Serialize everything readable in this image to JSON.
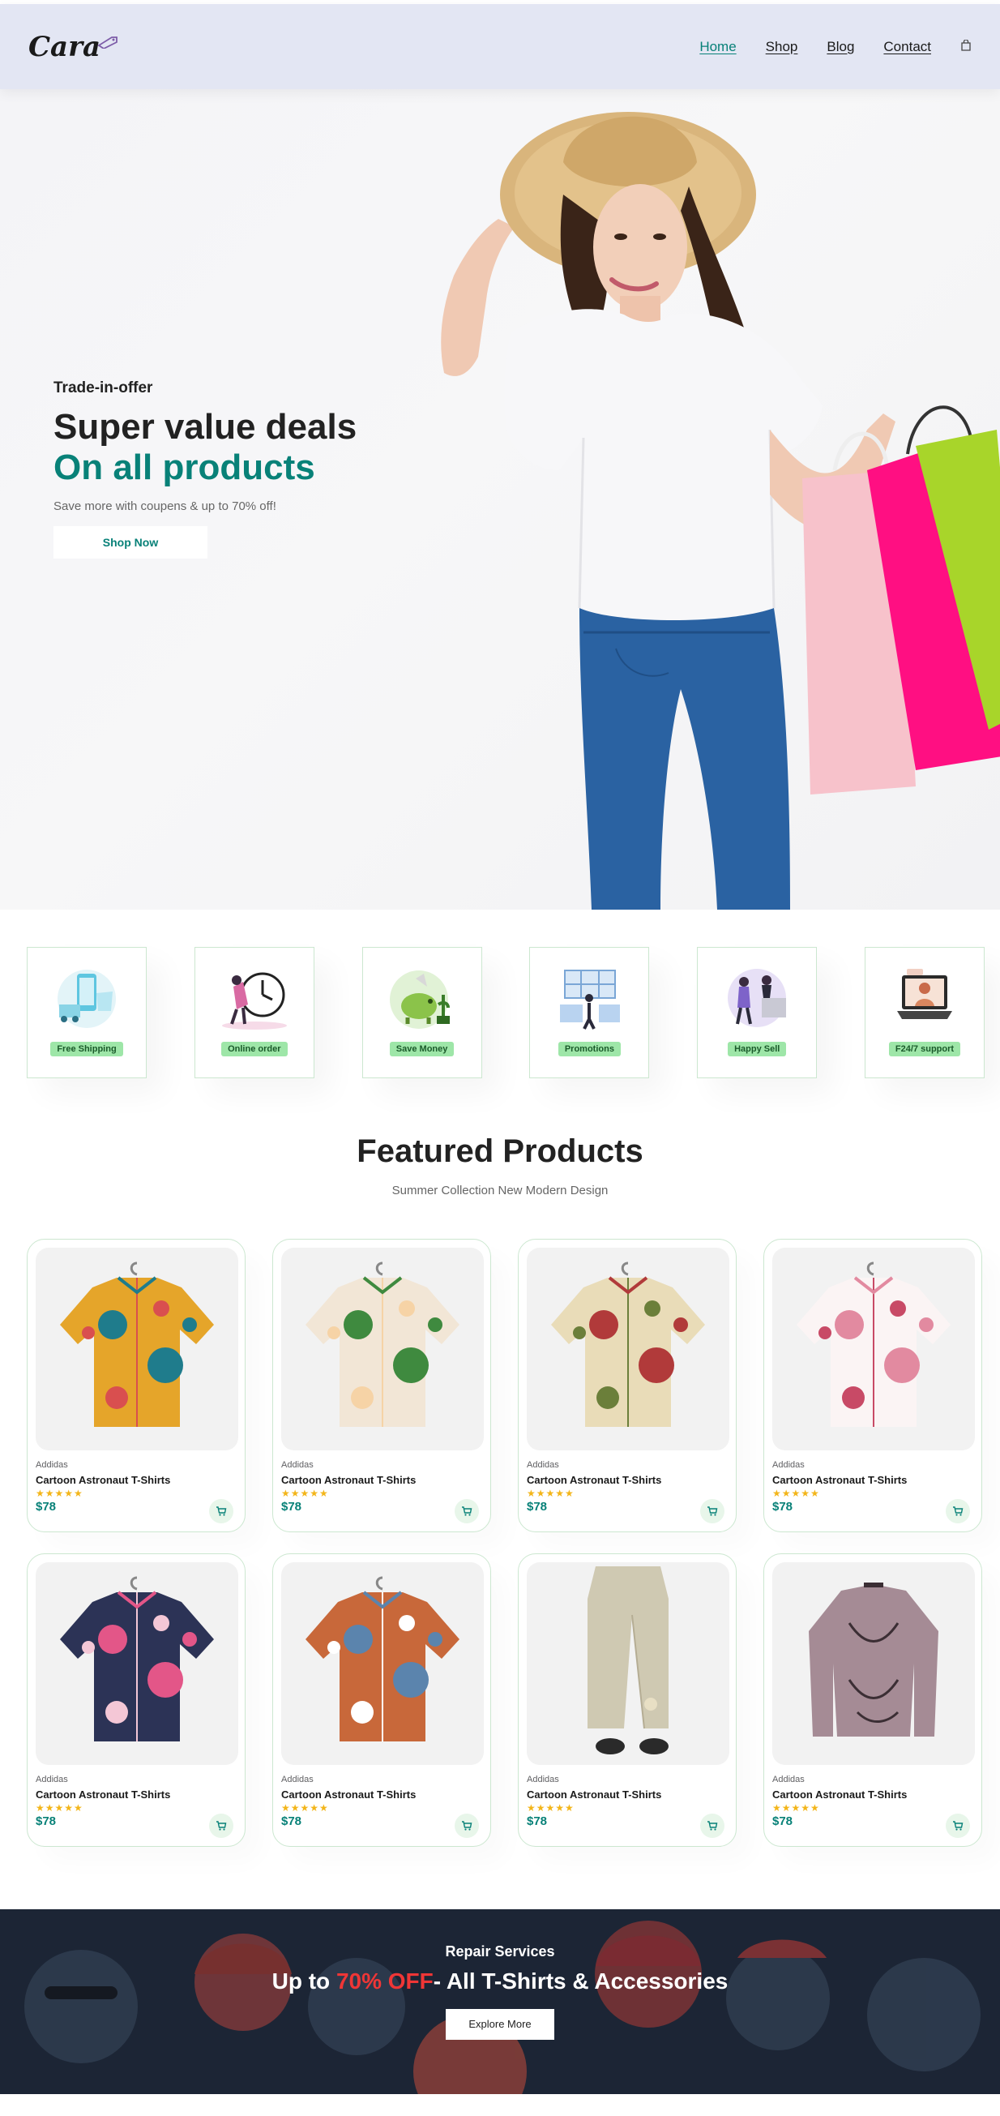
{
  "header": {
    "logo_text": "Cara",
    "nav": [
      {
        "label": "Home",
        "active": true
      },
      {
        "label": "Shop"
      },
      {
        "label": "Blog"
      },
      {
        "label": "Contact"
      }
    ],
    "cart_icon": "bag-icon"
  },
  "hero": {
    "kicker": "Trade-in-offer",
    "title_line1": "Super value deals",
    "title_line2": "On all products",
    "subtitle": "Save more with coupens & up to 70% off!",
    "button": "Shop Now"
  },
  "features": [
    {
      "label": "Free Shipping",
      "icon": "phone-shipping-illustration"
    },
    {
      "label": "Online order",
      "icon": "clock-order-illustration"
    },
    {
      "label": "Save Money",
      "icon": "piggy-bank-illustration"
    },
    {
      "label": "Promotions",
      "icon": "promotions-illustration"
    },
    {
      "label": "Happy Sell",
      "icon": "happy-sell-illustration"
    },
    {
      "label": "F24/7 support",
      "icon": "support-illustration"
    }
  ],
  "featured": {
    "title": "Featured Products",
    "subtitle": "Summer Collection New Modern Design",
    "products": [
      {
        "brand": "Addidas",
        "name": "Cartoon Astronaut T-Shirts",
        "rating": 5,
        "price": "$78",
        "stars": "★★★★★",
        "colors": [
          "#e5a52a",
          "#1f7c8c",
          "#d94f4f"
        ]
      },
      {
        "brand": "Addidas",
        "name": "Cartoon Astronaut T-Shirts",
        "rating": 5,
        "price": "$78",
        "stars": "★★★★★",
        "colors": [
          "#f2e6d6",
          "#3f8a3f",
          "#f6d3a6"
        ]
      },
      {
        "brand": "Addidas",
        "name": "Cartoon Astronaut T-Shirts",
        "rating": 5,
        "price": "$78",
        "stars": "★★★★★",
        "colors": [
          "#e9dcb8",
          "#b13a3a",
          "#6b7f3a"
        ]
      },
      {
        "brand": "Addidas",
        "name": "Cartoon Astronaut T-Shirts",
        "rating": 5,
        "price": "$78",
        "stars": "★★★★★",
        "colors": [
          "#fbf4f4",
          "#e28aa0",
          "#c84a66"
        ]
      },
      {
        "brand": "Addidas",
        "name": "Cartoon Astronaut T-Shirts",
        "rating": 5,
        "price": "$78",
        "stars": "★★★★★",
        "colors": [
          "#2c3356",
          "#e35688",
          "#f4c7d6"
        ]
      },
      {
        "brand": "Addidas",
        "name": "Cartoon Astronaut T-Shirts",
        "rating": 5,
        "price": "$78",
        "stars": "★★★★★",
        "colors": [
          "#c8683a",
          "#5b84ad",
          "#ffffff"
        ]
      },
      {
        "brand": "Addidas",
        "name": "Cartoon Astronaut T-Shirts",
        "rating": 5,
        "price": "$78",
        "stars": "★★★★★",
        "colors": [
          "#cfc9b2",
          "#b5ad94",
          "#2a2a2a"
        ]
      },
      {
        "brand": "Addidas",
        "name": "Cartoon Astronaut T-Shirts",
        "rating": 5,
        "price": "$78",
        "stars": "★★★★★",
        "colors": [
          "#a58b95",
          "#3b2e34",
          "#c4adb6"
        ]
      }
    ]
  },
  "banner": {
    "kicker": "Repair Services",
    "title_prefix": "Up to ",
    "title_accent": "70% OFF",
    "title_suffix": "- All T-Shirts & Accessories",
    "button": "Explore More"
  },
  "colors": {
    "accent": "#088178",
    "header_bg": "#e3e6f3",
    "badge_bg": "#9ee6a8",
    "banner_bg": "#1d2636",
    "banner_accent": "#ef3636",
    "star": "#f3b519"
  }
}
